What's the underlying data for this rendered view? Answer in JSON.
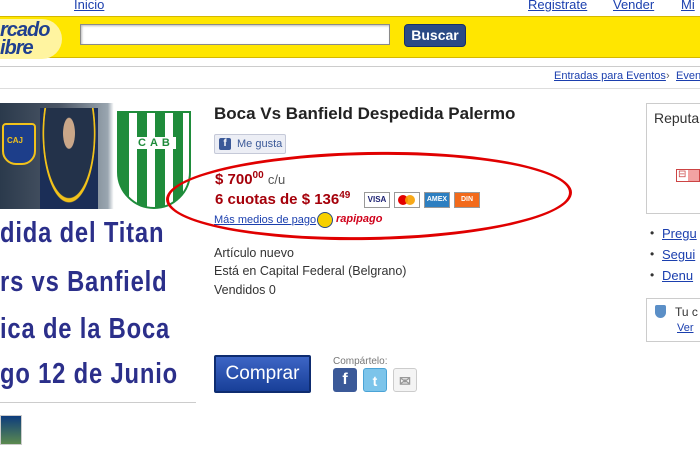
{
  "header": {
    "logo_line1": "rcado",
    "logo_line2": "ibre",
    "links": [
      "Inicio",
      "Registrate",
      "Vender",
      "Mi"
    ],
    "search_placeholder": "",
    "search_button": "Buscar",
    "breadcrumb": [
      "Entradas para Eventos",
      "Even"
    ]
  },
  "poster": {
    "crest_text": "CAJ",
    "stripes_text": "CAB",
    "lines": [
      "dida del Titan",
      "rs vs Banfield",
      "ica de la Boca",
      "go 12 de Junio"
    ]
  },
  "product": {
    "title": "Boca Vs Banfield Despedida Palermo",
    "like_label": "Me gusta",
    "price_currency": "$",
    "price_int": "700",
    "price_dec": "00",
    "price_unit": "c/u",
    "installments_text": "6 cuotas de $ 136",
    "installments_dec": "49",
    "cards": [
      "VISA",
      "MC",
      "AMEX",
      "DIN"
    ],
    "more_payments": "Más medios de pago",
    "rapipago": "rapipago",
    "condition": "Artículo nuevo",
    "location": "Está en Capital Federal (Belgrano)",
    "sold": "Vendidos  0",
    "buy_button": "Comprar",
    "share_label": "Compártelo:"
  },
  "sidebar": {
    "reputation_label": "Reputa",
    "links": [
      "Pregu",
      "Segui",
      "Denu"
    ],
    "safe_text": "Tu c",
    "safe_link": "Ver"
  },
  "colors": {
    "yellow": "#ffe600",
    "price_red": "#a5000a",
    "link_blue": "#1b3fae",
    "highlight_red": "#e00000"
  }
}
